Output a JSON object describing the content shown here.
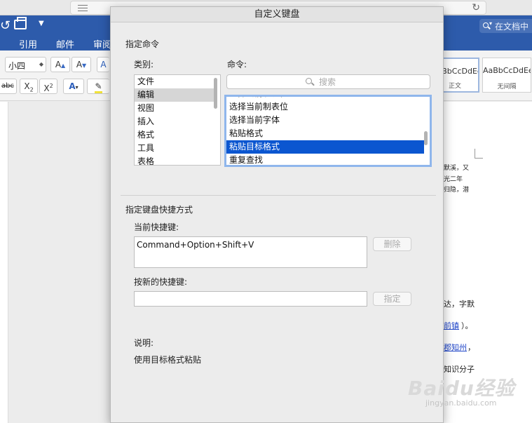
{
  "browser": {
    "reload_icon": "reload-icon"
  },
  "word": {
    "tabs": [
      "引用",
      "邮件",
      "审阅"
    ],
    "search_placeholder": "在文档中",
    "font_size": "小四",
    "toolbar": {
      "grow": "A",
      "shrink": "A",
      "strike": "abc",
      "sub": "X",
      "sup": "X"
    },
    "styles": [
      {
        "sample": "AaBbCcDdEe",
        "name": "正文"
      },
      {
        "sample": "AaBbCcDdEe",
        "name": "无间隔"
      }
    ],
    "doc_lines": [
      "默溪，又",
      "光二年",
      "归隐，潜",
      "达，字默",
      "前镇",
      "）。",
      "郡知州",
      "，",
      "知识分子"
    ]
  },
  "dialog": {
    "title": "自定义键盘",
    "command_section": "指定命令",
    "category_label": "类别:",
    "categories": [
      "文件",
      "编辑",
      "视图",
      "插入",
      "格式",
      "工具",
      "表格"
    ],
    "command_label": "命令:",
    "search_placeholder": "搜索",
    "commands": [
      "选择当前制表位",
      "选择当前制表位",
      "选择当前字体",
      "粘贴格式",
      "粘贴目标格式",
      "重复查找"
    ],
    "shortcut_section": "指定键盘快捷方式",
    "current_label": "当前快捷键:",
    "current_shortcut": "Command+Option+Shift+V",
    "delete_button": "删除",
    "new_label": "按新的快捷键:",
    "new_shortcut": "",
    "assign_button": "指定",
    "description_label": "说明:",
    "description": "使用目标格式粘贴"
  },
  "watermark": {
    "main": "Baidu经验",
    "sub": "jingyan.baidu.com"
  }
}
